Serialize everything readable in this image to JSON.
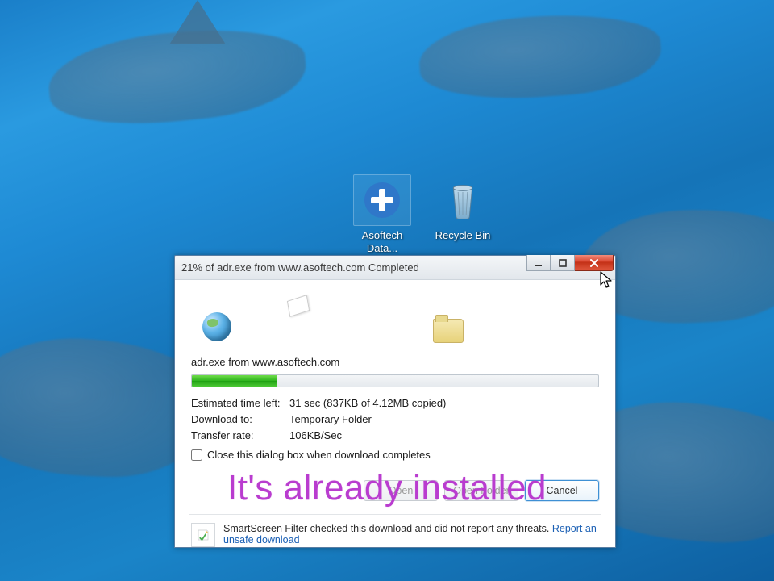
{
  "desktop": {
    "icons": [
      {
        "label": "Asoftech Data..."
      },
      {
        "label": "Recycle Bin"
      }
    ]
  },
  "dialog": {
    "title": "21% of adr.exe from www.asoftech.com Completed",
    "file_line": "adr.exe from www.asoftech.com",
    "progress_percent": 21,
    "stats": {
      "eta_label": "Estimated time left:",
      "eta_value": "31 sec (837KB of 4.12MB copied)",
      "dest_label": "Download to:",
      "dest_value": "Temporary Folder",
      "rate_label": "Transfer rate:",
      "rate_value": "106KB/Sec"
    },
    "close_checkbox_label": "Close this dialog box when download completes",
    "buttons": {
      "open": "Open",
      "open_folder": "Open Folder",
      "cancel": "Cancel"
    },
    "smartscreen": {
      "text": "SmartScreen Filter checked this download and did not report any threats.",
      "link": "Report an unsafe download"
    }
  },
  "overlay_caption": "It's already installed"
}
